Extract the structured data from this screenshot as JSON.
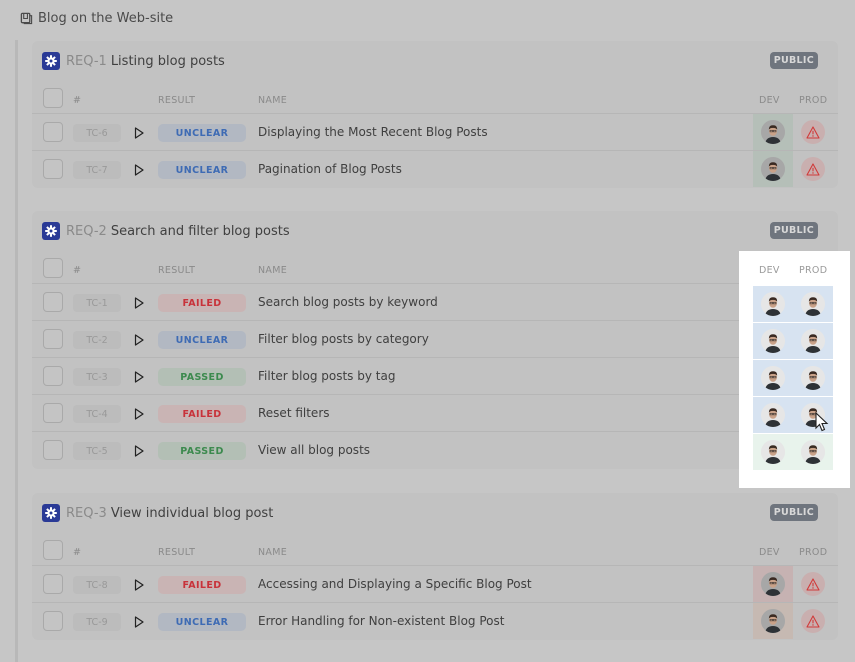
{
  "project": {
    "title": "Blog on the Web-site",
    "icon": "book-icon"
  },
  "columns": {
    "num": "#",
    "result": "RESULT",
    "name": "NAME",
    "dev": "DEV",
    "prod": "PROD"
  },
  "colors": {
    "gear_bg": "#2a3a96",
    "unclear": "#3e6bb4",
    "failed": "#c8323a",
    "passed": "#3c8a4e",
    "highlight_row_blue": "#d7e3f1",
    "highlight_row_green": "#e8f3ec"
  },
  "requirements": [
    {
      "code": "REQ-1",
      "title": "Listing blog posts",
      "badge": "PUBLIC",
      "tests": [
        {
          "id": "TC-6",
          "result": "UNCLEAR",
          "name": "Displaying the Most Recent Blog Posts",
          "dev": "avatar",
          "prod": "warning"
        },
        {
          "id": "TC-7",
          "result": "UNCLEAR",
          "name": "Pagination of Blog Posts",
          "dev": "avatar",
          "prod": "warning"
        }
      ]
    },
    {
      "code": "REQ-2",
      "title": "Search and filter blog posts",
      "badge": "PUBLIC",
      "tests": [
        {
          "id": "TC-1",
          "result": "FAILED",
          "name": "Search blog posts by keyword",
          "dev": "avatar",
          "prod": "avatar"
        },
        {
          "id": "TC-2",
          "result": "UNCLEAR",
          "name": "Filter blog posts by category",
          "dev": "avatar",
          "prod": "avatar"
        },
        {
          "id": "TC-3",
          "result": "PASSED",
          "name": "Filter blog posts by tag",
          "dev": "avatar",
          "prod": "avatar"
        },
        {
          "id": "TC-4",
          "result": "FAILED",
          "name": "Reset filters",
          "dev": "avatar",
          "prod": "avatar"
        },
        {
          "id": "TC-5",
          "result": "PASSED",
          "name": "View all blog posts",
          "dev": "avatar",
          "prod": "avatar"
        }
      ]
    },
    {
      "code": "REQ-3",
      "title": "View individual blog post",
      "badge": "PUBLIC",
      "tests": [
        {
          "id": "TC-8",
          "result": "FAILED",
          "name": "Accessing and Displaying a Specific Blog Post",
          "dev": "avatar",
          "prod": "warning"
        },
        {
          "id": "TC-9",
          "result": "UNCLEAR",
          "name": "Error Handling for Non-existent Blog Post",
          "dev": "avatar",
          "prod": "warning"
        }
      ]
    }
  ]
}
